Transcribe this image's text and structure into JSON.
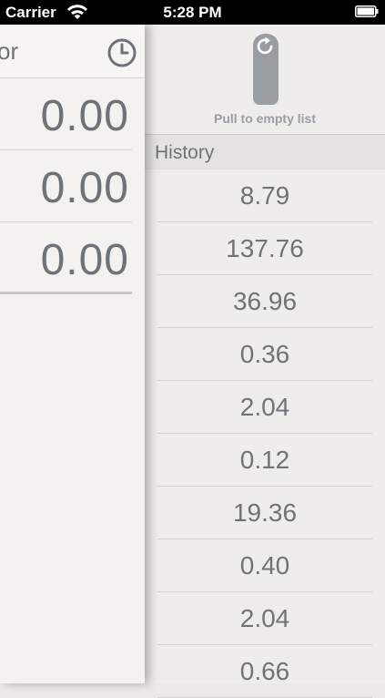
{
  "status_bar": {
    "carrier": "Carrier",
    "time": "5:28 PM"
  },
  "pull_action": {
    "label": "Pull to empty list"
  },
  "history": {
    "header": "History",
    "items": [
      "8.79",
      "137.76",
      "36.96",
      "0.36",
      "2.04",
      "0.12",
      "19.36",
      "0.40",
      "2.04",
      "0.66"
    ]
  },
  "calculator": {
    "title_fragment": "or",
    "values": [
      "0.00",
      "0.00",
      "0.00"
    ]
  },
  "colors": {
    "text": "#6f7378",
    "background": "#eceae8",
    "status_bar": "#000000"
  },
  "icons": [
    "wifi-icon",
    "battery-icon",
    "refresh-icon",
    "clock-icon"
  ]
}
